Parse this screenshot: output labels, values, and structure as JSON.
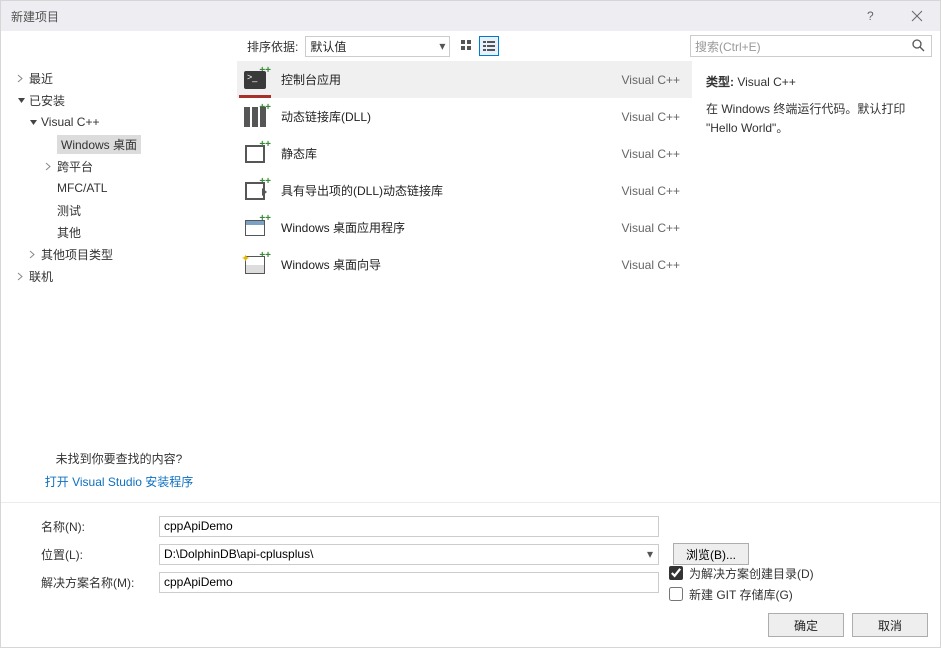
{
  "window": {
    "title": "新建项目"
  },
  "topstrip": {
    "sortLabel": "排序依据:",
    "sortValue": "默认值",
    "searchPlaceholder": "搜索(Ctrl+E)"
  },
  "sidebar": {
    "recent": "最近",
    "installed": "已安装",
    "vcpp": "Visual C++",
    "windowsDesktop": "Windows 桌面",
    "crossPlatform": "跨平台",
    "mfcAtl": "MFC/ATL",
    "test": "测试",
    "other": "其他",
    "otherProjectTypes": "其他项目类型",
    "online": "联机",
    "notFound": "未找到你要查找的内容?",
    "installerLink": "打开 Visual Studio 安装程序"
  },
  "templates": [
    {
      "name": "控制台应用",
      "lang": "Visual C++",
      "selected": true,
      "icon": "console"
    },
    {
      "name": "动态链接库(DLL)",
      "lang": "Visual C++",
      "icon": "dll"
    },
    {
      "name": "静态库",
      "lang": "Visual C++",
      "icon": "static"
    },
    {
      "name": "具有导出项的(DLL)动态链接库",
      "lang": "Visual C++",
      "icon": "export"
    },
    {
      "name": "Windows 桌面应用程序",
      "lang": "Visual C++",
      "icon": "winapp"
    },
    {
      "name": "Windows 桌面向导",
      "lang": "Visual C++",
      "icon": "wizard"
    }
  ],
  "detail": {
    "typeLabel": "类型:",
    "typeValue": "Visual C++",
    "description": "在 Windows 终端运行代码。默认打印 \"Hello World\"。"
  },
  "form": {
    "nameLabel": "名称(N):",
    "nameValue": "cppApiDemo",
    "locationLabel": "位置(L):",
    "locationValue": "D:\\DolphinDB\\api-cplusplus\\",
    "solutionLabel": "解决方案名称(M):",
    "solutionValue": "cppApiDemo",
    "browse": "浏览(B)...",
    "createDir": "为解决方案创建目录(D)",
    "createGit": "新建 GIT 存储库(G)"
  },
  "footer": {
    "ok": "确定",
    "cancel": "取消"
  }
}
